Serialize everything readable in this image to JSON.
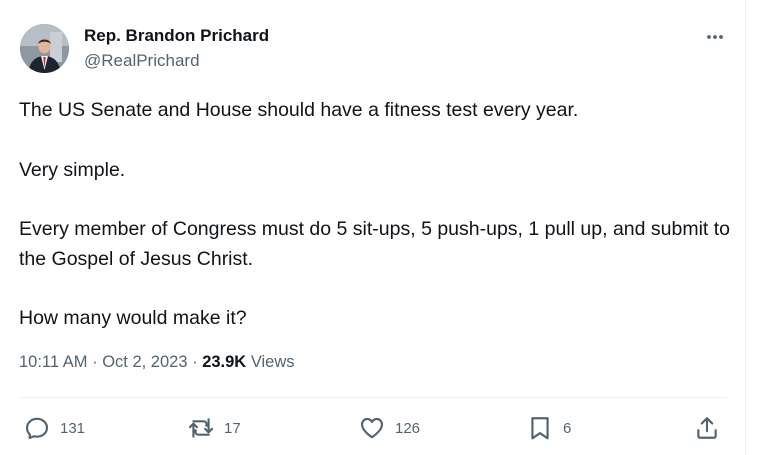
{
  "tweet": {
    "author": {
      "display_name": "Rep. Brandon Prichard",
      "handle": "@RealPrichard",
      "avatar_icon": "profile-photo"
    },
    "paragraphs": [
      "The US Senate and House should have a fitness test every year.",
      "Very simple.",
      "Every member of Congress must do 5 sit-ups, 5 push-ups, 1 pull up, and submit to the Gospel of Jesus Christ.",
      "How many would make it?"
    ],
    "meta": {
      "time": "10:11 AM",
      "separator": "·",
      "date": "Oct 2, 2023",
      "views_count": "23.9K",
      "views_label": "Views"
    },
    "actions": {
      "reply_count": "131",
      "retweet_count": "17",
      "like_count": "126",
      "bookmark_count": "6"
    }
  },
  "colors": {
    "text_primary": "#0f1419",
    "text_secondary": "#536471",
    "divider": "#eff3f4"
  }
}
